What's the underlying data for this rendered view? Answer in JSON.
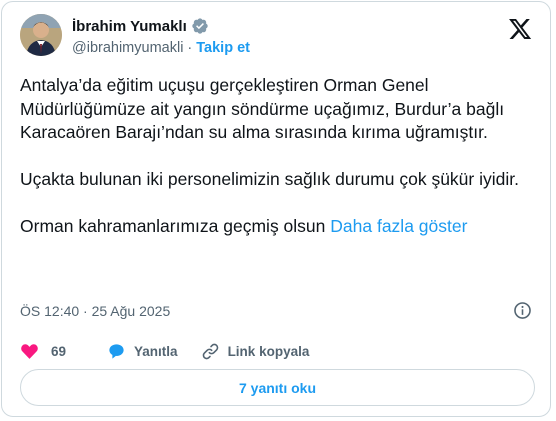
{
  "author": {
    "display_name": "İbrahim Yumaklı",
    "handle": "@ibrahimyumakli",
    "separator": "·",
    "follow_label": "Takip et"
  },
  "tweet": {
    "paragraphs": [
      "Antalya’da eğitim uçuşu gerçekleştiren Orman Genel Müdürlüğümüze ait yangın söndürme uçağımız, Burdur’a bağlı Karacaören Barajı’ndan su alma sırasında kırıma uğramıştır.",
      "Uçakta bulunan iki personelimizin sağlık durumu çok şükür iyidir."
    ],
    "last_paragraph": "Orman kahramanlarımıza geçmiş olsun",
    "show_more_label": "Daha fazla göster",
    "timestamp": "ÖS 12:40 · 25 Ağu 2025"
  },
  "actions": {
    "like_count": "69",
    "reply_label": "Yanıtla",
    "copy_link_label": "Link kopyala",
    "read_replies_label": "7 yanıtı oku"
  },
  "colors": {
    "accent": "#1d9bf0",
    "like": "#f91880",
    "muted": "#536471"
  },
  "icons": [
    "verified-badge-icon",
    "x-logo-icon",
    "info-icon",
    "heart-icon",
    "reply-bubble-icon",
    "link-icon"
  ]
}
